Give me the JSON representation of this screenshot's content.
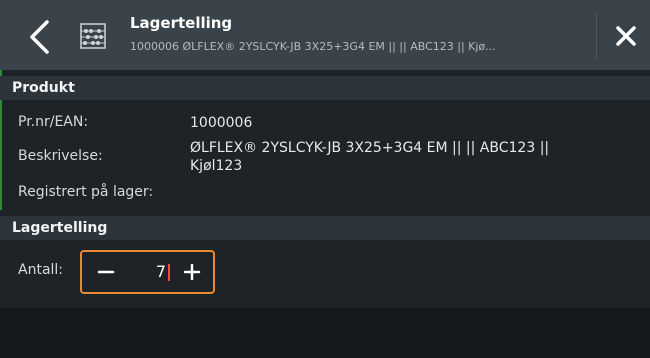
{
  "header": {
    "title": "Lagertelling",
    "subtitle": "1000006 ØLFLEX® 2YSLCYK-JB 3X25+3G4 EM ||   || ABC123 || Kjø...",
    "back_icon": "chevron-left-icon",
    "app_icon": "abacus-icon",
    "close_icon": "close-icon"
  },
  "produkt": {
    "section_title": "Produkt",
    "rows": [
      {
        "label": "Pr.nr/EAN:",
        "value": "1000006"
      },
      {
        "label": "Beskrivelse:",
        "value_line1": "ØLFLEX® 2YSLCYK-JB 3X25+3G4 EM ||   || ABC123 ||",
        "value_line2": "Kjøl123"
      },
      {
        "label": "Registrert på lager:",
        "value": ""
      }
    ]
  },
  "lagertelling": {
    "section_title": "Lagertelling",
    "quantity_label": "Antall:",
    "quantity_value": "7",
    "minus_icon": "minus-icon",
    "plus_icon": "plus-icon"
  },
  "colors": {
    "accent": "#e88a2e",
    "header_bg": "#3a4349",
    "body_bg": "#1e2327",
    "caret": "#ff4a2a"
  }
}
